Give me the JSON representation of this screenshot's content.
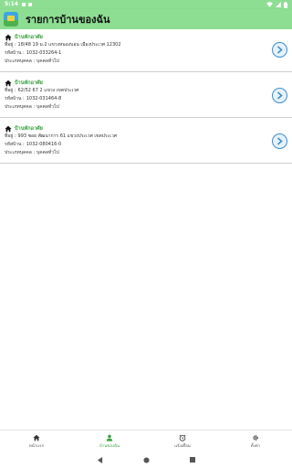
{
  "status_bar": {
    "time": "5:14"
  },
  "app_bar": {
    "title": "รายการบ้านของฉัน"
  },
  "houses": [
    {
      "title": "บ้านพักอาศัย",
      "address_label": "ที่อยู่ :",
      "address": "18/48 19 ม.2  แขวงหนองบอน เมืองประเวศ 12302",
      "code_label": "รหัสบ้าน :",
      "code": "1032-033264-1",
      "type_label": "ประเภทบุคคล :",
      "type": "บุคคลทั่วไป"
    },
    {
      "title": "บ้านพักอาศัย",
      "address_label": "ที่อยู่ :",
      "address": "62/52 67 2  แขวง เขตประเวศ",
      "code_label": "รหัสบ้าน :",
      "code": "1032-031464-8",
      "type_label": "ประเภทบุคคล :",
      "type": "บุคคลทั่วไป"
    },
    {
      "title": "บ้านพักอาศัย",
      "address_label": "ที่อยู่ :",
      "address": "993  ซอย พัฒนาการ 61  แขวงประเวศ เขตประเวศ",
      "code_label": "รหัสบ้าน :",
      "code": "1032-080416-0",
      "type_label": "ประเภทบุคคล :",
      "type": "บุคคลทั่วไป"
    }
  ],
  "bottom_nav": [
    {
      "label": "หน้าแรก",
      "icon": "home-icon",
      "active": false
    },
    {
      "label": "บ้านของฉัน",
      "icon": "person-icon",
      "active": true
    },
    {
      "label": "แจ้งเตือน",
      "icon": "clock-icon",
      "active": false
    },
    {
      "label": "ตั้งค่า",
      "icon": "gear-icon",
      "active": false
    }
  ],
  "colors": {
    "accent_green": "#8dde93",
    "title_green": "#3aa13f",
    "chevron_blue": "#3d8fcf"
  }
}
